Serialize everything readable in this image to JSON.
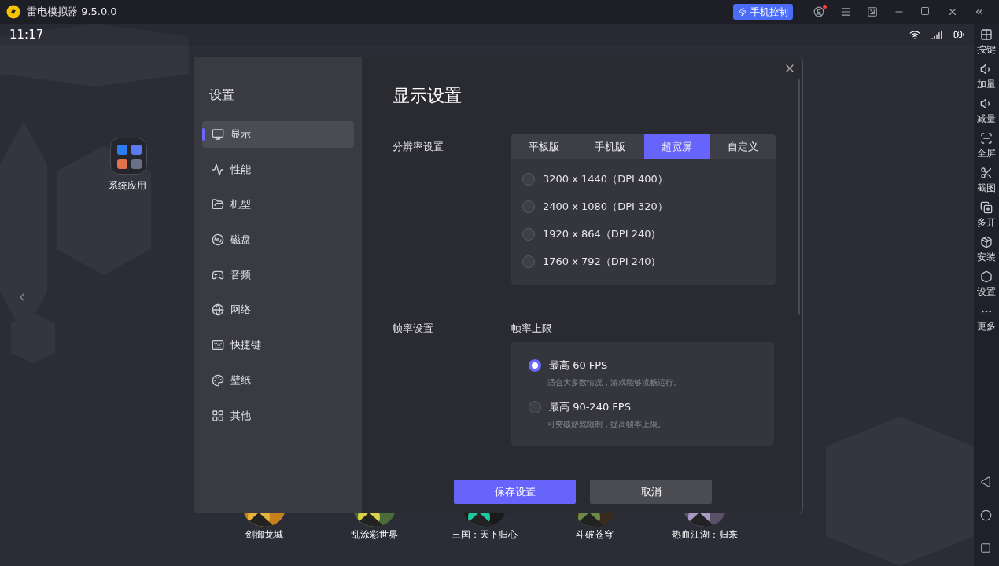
{
  "title_bar": {
    "app_title": "雷电模拟器 9.5.0.0",
    "control_button": "手机控制",
    "account_alert": true
  },
  "status_bar": {
    "time": "11:17"
  },
  "toolbar": [
    {
      "label": "按键"
    },
    {
      "label": "加量"
    },
    {
      "label": "减量"
    },
    {
      "label": "全屏"
    },
    {
      "label": "截图"
    },
    {
      "label": "多开"
    },
    {
      "label": "安装"
    },
    {
      "label": "设置"
    },
    {
      "label": "更多"
    }
  ],
  "desktop": {
    "folder": {
      "label": "系统应用"
    },
    "dock": [
      {
        "label": "剑御龙城",
        "kind": "picture"
      },
      {
        "label": "乱涂彩世界",
        "kind": "picture"
      },
      {
        "label": "三国：天下归心",
        "kind": "picture"
      },
      {
        "label": "斗破苍穹",
        "kind": "picture"
      },
      {
        "label": "热血江湖：归来",
        "kind": "picture"
      }
    ]
  },
  "dialog": {
    "title": "设置",
    "nav": [
      {
        "label": "显示",
        "selected": true
      },
      {
        "label": "性能",
        "selected": false
      },
      {
        "label": "机型",
        "selected": false
      },
      {
        "label": "磁盘",
        "selected": false
      },
      {
        "label": "音频",
        "selected": false
      },
      {
        "label": "网络",
        "selected": false
      },
      {
        "label": "快捷键",
        "selected": false
      },
      {
        "label": "壁纸",
        "selected": false
      },
      {
        "label": "其他",
        "selected": false
      }
    ],
    "heading": "显示设置",
    "resolution": {
      "label": "分辨率设置",
      "tabs": [
        {
          "label": "平板版",
          "selected": false
        },
        {
          "label": "手机版",
          "selected": false
        },
        {
          "label": "超宽屏",
          "selected": true
        },
        {
          "label": "自定义",
          "selected": false
        }
      ],
      "options": [
        {
          "label": "3200 x 1440（DPI 400）",
          "selected": false
        },
        {
          "label": "2400 x 1080（DPI 320）",
          "selected": false
        },
        {
          "label": "1920 x 864（DPI 240）",
          "selected": false
        },
        {
          "label": "1760 x 792（DPI 240）",
          "selected": false
        }
      ]
    },
    "framerate": {
      "label": "帧率设置",
      "sublabel": "帧率上限",
      "options": [
        {
          "label": "最高 60 FPS",
          "hint": "适合大多数情况，游戏能够流畅运行。",
          "selected": true
        },
        {
          "label": "最高 90-240 FPS",
          "hint": "可突破游戏限制，提高帧率上限。",
          "selected": false
        }
      ]
    },
    "buttons": [
      {
        "label": "保存设置",
        "kind": "primary"
      },
      {
        "label": "取消",
        "kind": "secondary"
      }
    ]
  }
}
